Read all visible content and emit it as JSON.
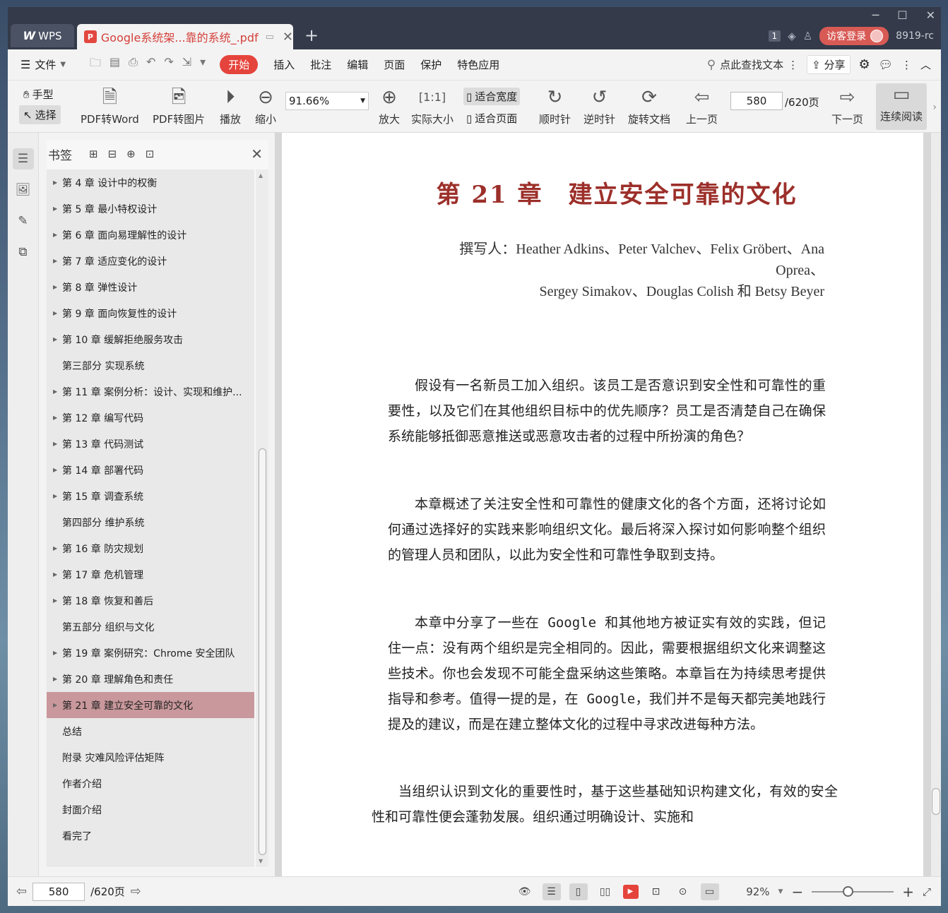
{
  "tabbar": {
    "wps_label": "WPS",
    "doc_title": "Google系统架...靠的系统_.pdf",
    "badge": "1",
    "login": "访客登录",
    "user": "8919-rc"
  },
  "menu": {
    "file": "文件",
    "items": [
      "开始",
      "插入",
      "批注",
      "编辑",
      "页面",
      "保护",
      "特色应用"
    ],
    "search": "点此查找文本",
    "share": "分享"
  },
  "toolbar": {
    "hand": "手型",
    "select": "选择",
    "pdf_to_word": "PDF转Word",
    "pdf_to_image": "PDF转图片",
    "play": "播放",
    "zoom_out": "缩小",
    "zoom_value": "91.66%",
    "zoom_in": "放大",
    "actual_size": "实际大小",
    "fit_width": "适合宽度",
    "fit_page": "适合页面",
    "clockwise": "顺时针",
    "counter_clockwise": "逆时针",
    "rotate_doc": "旋转文档",
    "prev_page": "上一页",
    "page": "580",
    "total": "/620页",
    "next_page": "下一页",
    "continuous": "连续阅读"
  },
  "bookmarks": {
    "title": "书签",
    "items": [
      {
        "label": "第 4 章 设计中的权衡",
        "arrow": true
      },
      {
        "label": "第 5 章 最小特权设计",
        "arrow": true
      },
      {
        "label": "第 6 章 面向易理解性的设计",
        "arrow": true
      },
      {
        "label": "第 7 章 适应变化的设计",
        "arrow": true
      },
      {
        "label": "第 8 章 弹性设计",
        "arrow": true
      },
      {
        "label": "第 9 章 面向恢复性的设计",
        "arrow": true
      },
      {
        "label": "第 10 章 缓解拒绝服务攻击",
        "arrow": true
      },
      {
        "label": "第三部分 实现系统",
        "arrow": false
      },
      {
        "label": "第 11 章 案例分析：设计、实现和维护...",
        "arrow": true
      },
      {
        "label": "第 12 章 编写代码",
        "arrow": true
      },
      {
        "label": "第 13 章 代码测试",
        "arrow": true
      },
      {
        "label": "第 14 章 部署代码",
        "arrow": true
      },
      {
        "label": "第 15 章 调查系统",
        "arrow": true
      },
      {
        "label": "第四部分 维护系统",
        "arrow": false
      },
      {
        "label": "第 16 章 防灾规划",
        "arrow": true
      },
      {
        "label": "第 17 章 危机管理",
        "arrow": true
      },
      {
        "label": "第 18 章 恢复和善后",
        "arrow": true
      },
      {
        "label": "第五部分 组织与文化",
        "arrow": false
      },
      {
        "label": "第 19 章 案例研究：Chrome 安全团队",
        "arrow": true
      },
      {
        "label": "第 20 章 理解角色和责任",
        "arrow": true
      },
      {
        "label": "第 21 章 建立安全可靠的文化",
        "arrow": true,
        "selected": true
      },
      {
        "label": "总结",
        "arrow": false
      },
      {
        "label": "附录 灾难风险评估矩阵",
        "arrow": false
      },
      {
        "label": "作者介绍",
        "arrow": false
      },
      {
        "label": "封面介绍",
        "arrow": false
      },
      {
        "label": "看完了",
        "arrow": false
      }
    ]
  },
  "document": {
    "chapter_title": "第 21 章　建立安全可靠的文化",
    "authors_line1": "撰写人：Heather Adkins、Peter Valchev、Felix Gröbert、Ana",
    "authors_line2": "Oprea、",
    "authors_line3": "Sergey Simakov、Douglas Colish 和 Betsy Beyer",
    "para1": "假设有一名新员工加入组织。该员工是否意识到安全性和可靠性的重要性，以及它们在其他组织目标中的优先顺序？员工是否清楚自己在确保系统能够抵御恶意推送或恶意攻击者的过程中所扮演的角色？",
    "para2": "本章概述了关注安全性和可靠性的健康文化的各个方面，还将讨论如何通过选择好的实践来影响组织文化。最后将深入探讨如何影响整个组织的管理人员和团队，以此为安全性和可靠性争取到支持。",
    "para3": "本章中分享了一些在 Google 和其他地方被证实有效的实践，但记住一点：没有两个组织是完全相同的。因此，需要根据组织文化来调整这些技术。你也会发现不可能全盘采纳这些策略。本章旨在为持续思考提供指导和参考。值得一提的是，在 Google，我们并不是每天都完美地践行提及的建议，而是在建立整体文化的过程中寻求改进每种方法。",
    "para4": "当组织认识到文化的重要性时，基于这些基础知识构建文化，有效的安全性和可靠性便会蓬勃发展。组织通过明确设计、实施和"
  },
  "statusbar": {
    "page": "580",
    "total": "/620页",
    "zoom": "92%"
  }
}
